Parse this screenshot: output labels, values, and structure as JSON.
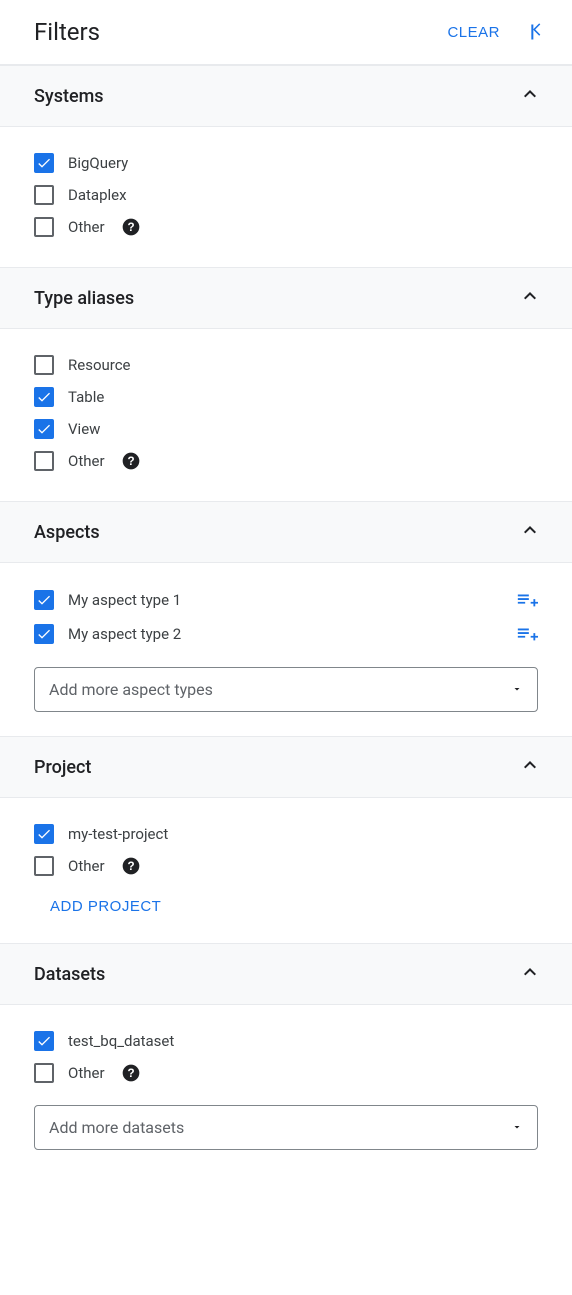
{
  "header": {
    "title": "Filters",
    "clear": "CLEAR"
  },
  "sections": {
    "systems": {
      "title": "Systems",
      "items": [
        {
          "label": "BigQuery",
          "checked": true,
          "help": false
        },
        {
          "label": "Dataplex",
          "checked": false,
          "help": false
        },
        {
          "label": "Other",
          "checked": false,
          "help": true
        }
      ]
    },
    "type_aliases": {
      "title": "Type aliases",
      "items": [
        {
          "label": "Resource",
          "checked": false,
          "help": false
        },
        {
          "label": "Table",
          "checked": true,
          "help": false
        },
        {
          "label": "View",
          "checked": true,
          "help": false
        },
        {
          "label": "Other",
          "checked": false,
          "help": true
        }
      ]
    },
    "aspects": {
      "title": "Aspects",
      "items": [
        {
          "label": "My aspect type 1",
          "checked": true,
          "action": true
        },
        {
          "label": "My aspect type 2",
          "checked": true,
          "action": true
        }
      ],
      "dropdown_placeholder": "Add more aspect types"
    },
    "project": {
      "title": "Project",
      "items": [
        {
          "label": "my-test-project",
          "checked": true,
          "help": false
        },
        {
          "label": "Other",
          "checked": false,
          "help": true
        }
      ],
      "add_button": "ADD PROJECT"
    },
    "datasets": {
      "title": "Datasets",
      "items": [
        {
          "label": "test_bq_dataset",
          "checked": true,
          "help": false
        },
        {
          "label": "Other",
          "checked": false,
          "help": true
        }
      ],
      "dropdown_placeholder": "Add more datasets"
    }
  }
}
